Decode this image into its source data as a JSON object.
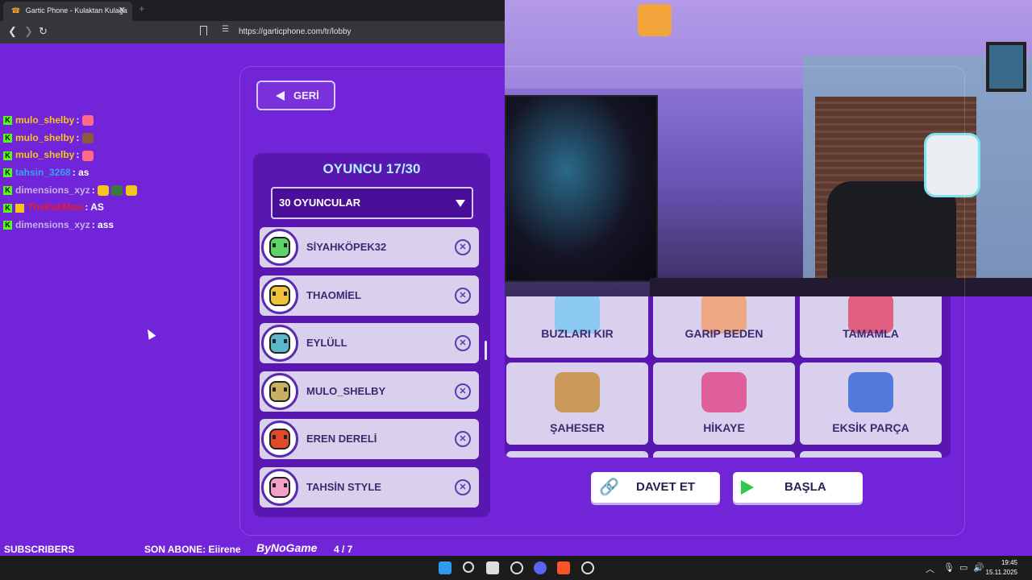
{
  "browser": {
    "tab_title": "Gartic Phone - Kulaktan Kulağa",
    "tab_close": "✕",
    "new_tab": "+",
    "url": "https://garticphone.com/tr/lobby"
  },
  "game": {
    "back_label": "GERİ",
    "players_title": "OYUNCU 17/30",
    "players_select": "30 OYUNCULAR",
    "players": [
      {
        "name": "SİYAHKÖPEK32",
        "color": "#5fd26a"
      },
      {
        "name": "THAOMİEL",
        "color": "#f0c23a"
      },
      {
        "name": "EYLÜLL",
        "color": "#5ab8c8"
      },
      {
        "name": "MULO_SHELBY",
        "color": "#c8b060"
      },
      {
        "name": "EREN DERELİ",
        "color": "#e04a2a"
      },
      {
        "name": "TAHSİN STYLE",
        "color": "#f2a0c8"
      }
    ],
    "modes": [
      {
        "label": "BUZLARI KIR",
        "icon": "ice-hammer-icon",
        "color": "#7ec8f0"
      },
      {
        "label": "GARIP BEDEN",
        "icon": "strange-body-icon",
        "color": "#f0a070"
      },
      {
        "label": "TAMAMLA",
        "icon": "complete-icon",
        "color": "#e04a6a"
      },
      {
        "label": "ŞAHESER",
        "icon": "masterpiece-icon",
        "color": "#c89040"
      },
      {
        "label": "HİKAYE",
        "icon": "story-icon",
        "color": "#e04a8a"
      },
      {
        "label": "EKSİK PARÇA",
        "icon": "missing-piece-icon",
        "color": "#3a6ad8"
      }
    ],
    "invite_label": "DAVET ET",
    "start_label": "BAŞLA"
  },
  "chat": [
    {
      "user": "mulo_shelby",
      "sep": ":",
      "msg": "",
      "user_color": "#f5c518",
      "emote": "#ff6a8a"
    },
    {
      "user": "mulo_shelby",
      "sep": ":",
      "msg": "",
      "user_color": "#f5c518",
      "emote": "#8a5a3a"
    },
    {
      "user": "mulo_shelby",
      "sep": ":",
      "msg": "",
      "user_color": "#f5c518",
      "emote": "#ff6a8a"
    },
    {
      "user": "tahsin_3268",
      "sep": ":",
      "msg": "as",
      "user_color": "#3aa0f0",
      "emote": ""
    },
    {
      "user": "dimensions_xyz",
      "sep": ":",
      "msg": "",
      "user_color": "#c8b0e8",
      "emote": "#f5c518"
    },
    {
      "user": "TheKakMaw",
      "sep": ":",
      "msg": "AS",
      "user_color": "#e0202a",
      "emote": ""
    },
    {
      "user": "dimensions_xyz",
      "sep": ":",
      "msg": "ass",
      "user_color": "#c8b0e8",
      "emote": ""
    }
  ],
  "stream": {
    "subscribers_label": "SUBSCRIBERS",
    "last_sub": "SON ABONE: Eiirene",
    "brand": "ByNoGame",
    "counter": "4  / 7",
    "progress": 0.57
  },
  "taskbar": {
    "time": "19:45",
    "date": "15.11.2025"
  }
}
